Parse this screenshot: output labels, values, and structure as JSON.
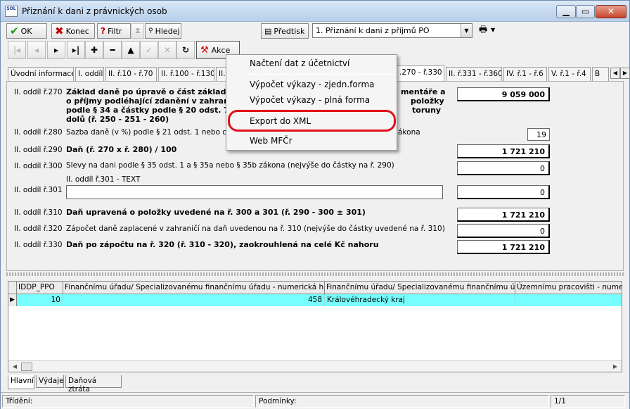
{
  "window": {
    "title": "Přiznání k dani z právnických osob",
    "app_icon_text": "SOL"
  },
  "toolbar1": {
    "ok": "OK",
    "konec": "Konec",
    "filtr": "Filtr",
    "hledej": "Hledej",
    "predtisk": "Předtisk",
    "form_select": "1. Přiznání k dani z příjmů PO"
  },
  "toolbar2": {
    "akce": "Akce"
  },
  "tabs": [
    "Úvodní informace",
    "I. oddíl",
    "II. ř.10 - ř.70",
    "II. ř.100 - ř.130",
    "II. ř",
    ".270 - ř.330",
    "II. ř.331 - ř.360",
    "IV. ř.1 - ř.6",
    "V. ř.1 - ř.4",
    "B"
  ],
  "form": {
    "r270": {
      "label": "II. oddíl ř.270",
      "line1": "Základ daně po úpravě o část základ",
      "line1_tail": "mentáře a",
      "line2": "o příjmy podléhající zdanění v zahraničí",
      "line2_tail": "položky",
      "line3": "podle § 34 a částky podle § 20 odst. 7 n",
      "line3_tail": "toruny",
      "line4": "dolů (ř. 250 - 251 - 260)",
      "value": "9 059 000"
    },
    "r280": {
      "label": "II. oddíl ř.280",
      "desc": "Sazba daně (v %) podle § 21 odst. 1 nebo odst.",
      "desc_tail": "ákona",
      "value": "19"
    },
    "r290": {
      "label": "II. oddíl ř.290",
      "desc": "Daň (ř. 270 x ř. 280) / 100",
      "value": "1 721 210"
    },
    "r300": {
      "label": "II. oddíl ř.300",
      "desc": "Slevy na dani podle § 35 odst. 1 a § 35a nebo § 35b zákona (nejvýše do částky na ř. 290)",
      "value": "0"
    },
    "r301": {
      "label": "II. oddíl ř.301",
      "text_label": "II. oddíl ř.301 - TEXT",
      "value": "0"
    },
    "r310": {
      "label": "II. oddíl ř.310",
      "desc": "Daň upravená o položky uvedené na ř. 300 a 301 (ř. 290 - 300 ± 301)",
      "value": "1 721 210"
    },
    "r320": {
      "label": "II. oddíl ř.320",
      "desc": "Zápočet daně zaplacené v zahraničí na daň uvedenou na ř. 310  (nejvýše do částky uvedené na ř. 310)",
      "value": "0"
    },
    "r330": {
      "label": "II. oddíl ř.330",
      "desc": "Daň po zápočtu na ř. 320 (ř. 310 - 320), zaokrouhlená na celé Kč nahoru",
      "value": "1 721 210"
    }
  },
  "grid": {
    "columns": [
      "IDDP_PPO",
      "Finančnímu úřadu/ Specializovanému finančnímu úřadu - numerická hodnota",
      "Finančnímu úřadu/ Specializovanému finančnímu úřadu",
      "Územnímu pracovišti - numerick"
    ],
    "rows": [
      [
        "10",
        "458",
        "Královéhradecký kraj",
        ""
      ]
    ]
  },
  "bottom_tabs": [
    "Hlavní",
    "Výdaje",
    "Daňová ztráta"
  ],
  "status": {
    "trideni": "Třídění:",
    "podminky": "Podmínky:",
    "pos": "1/1"
  },
  "menu": {
    "items": [
      "Načtení dat z účetnictví",
      "Výpočet výkazy - zjedn.forma",
      "Výpočet výkazy - plná forma",
      "Export do XML",
      "Web MFČr"
    ]
  },
  "colors": {
    "grid_row": "#77ffff",
    "highlight": "#e0101a"
  }
}
